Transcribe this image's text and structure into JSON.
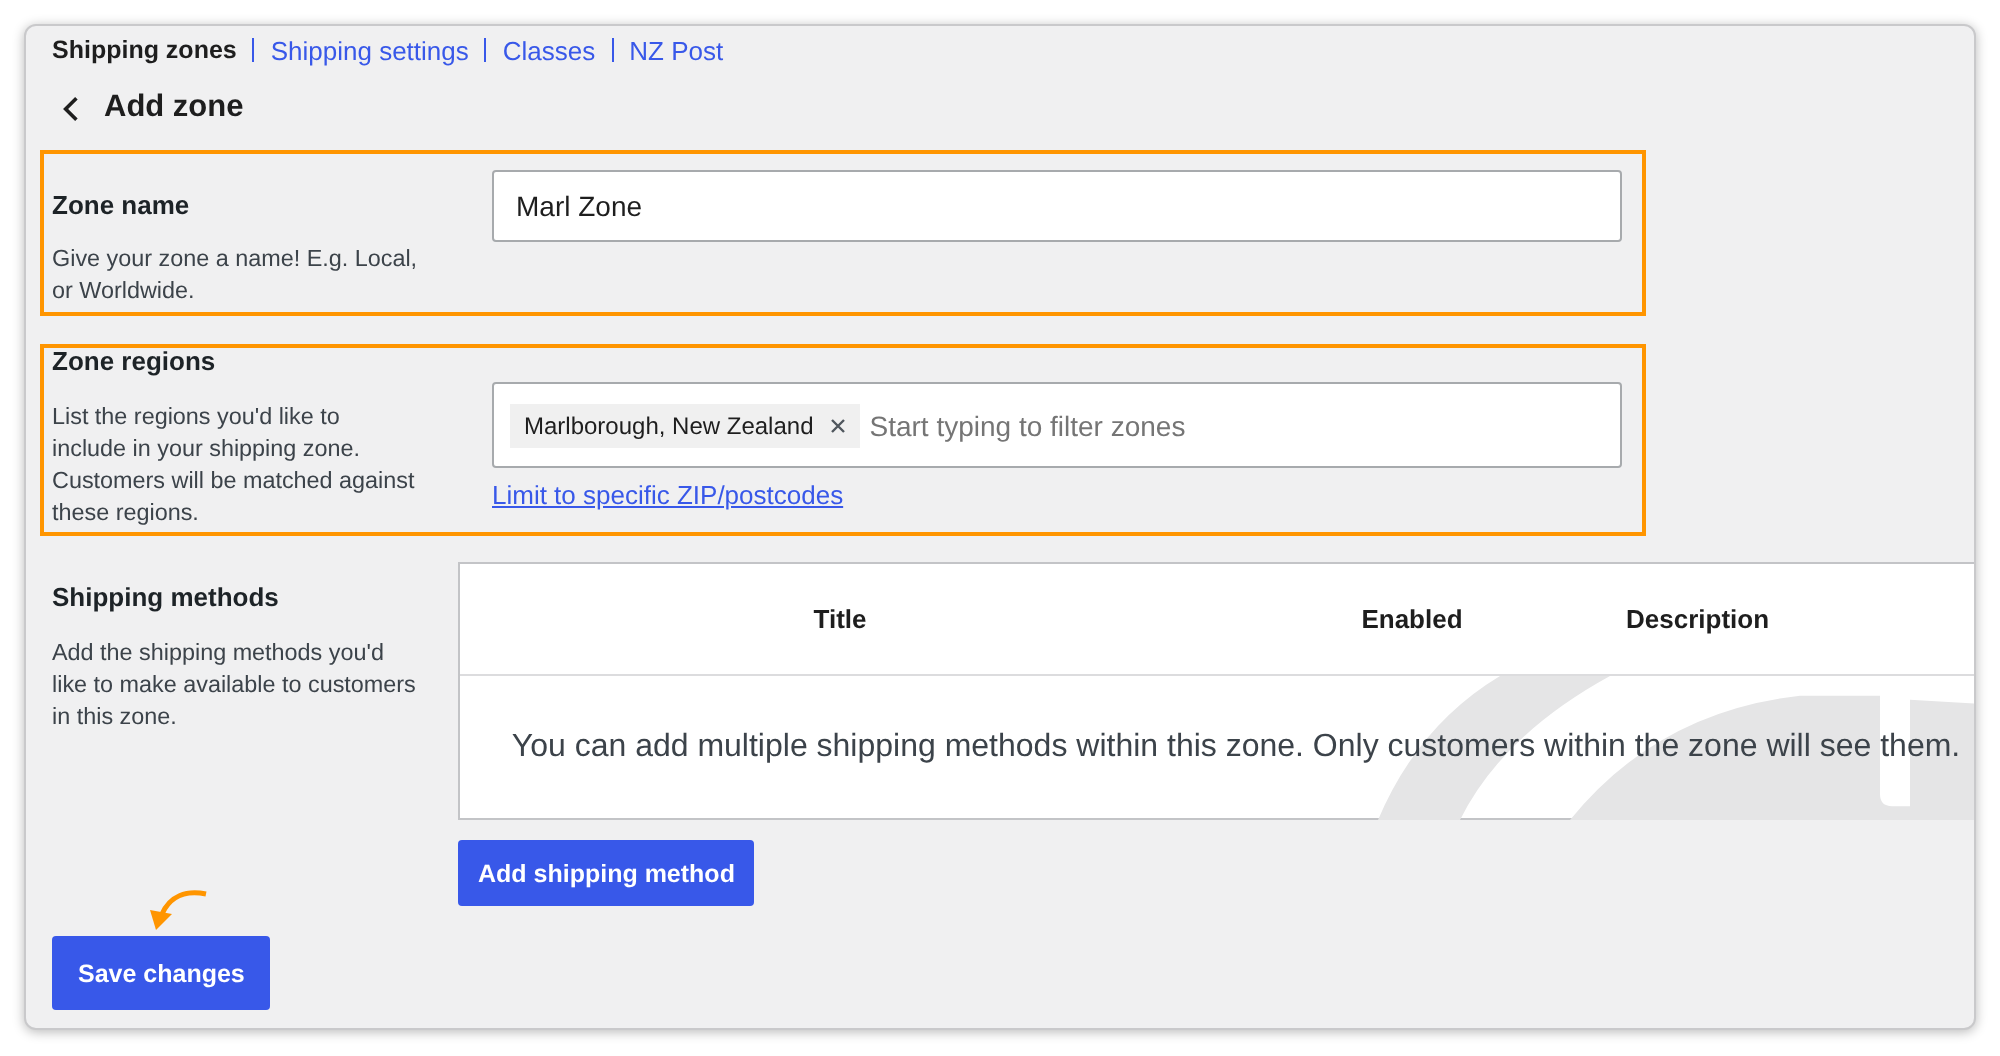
{
  "nav": [
    {
      "label": "Shipping zones",
      "selected": true
    },
    {
      "label": "Shipping settings",
      "selected": false
    },
    {
      "label": "Classes",
      "selected": false
    },
    {
      "label": "NZ Post",
      "selected": false
    }
  ],
  "page_title": "Add zone",
  "zone_name": {
    "label": "Zone name",
    "description": "Give your zone a name! E.g. Local, or Worldwide.",
    "value": "Marl Zone",
    "highlighted": true
  },
  "zone_regions": {
    "label": "Zone regions",
    "description": "List the regions you'd like to include in your shipping zone. Customers will be matched against these regions.",
    "chips": [
      {
        "label": "Marlborough, New Zealand"
      }
    ],
    "placeholder": "Start typing to filter zones",
    "link": "Limit to specific ZIP/postcodes",
    "highlighted": true
  },
  "shipping_methods": {
    "label": "Shipping methods",
    "description": "Add the shipping methods you'd like to make available to customers in this zone.",
    "columns": [
      "Title",
      "Enabled",
      "Description"
    ],
    "empty_message": "You can add multiple shipping methods within this zone. Only customers within the zone will see them.",
    "button": "Add shipping method"
  },
  "save_button": "Save changes"
}
